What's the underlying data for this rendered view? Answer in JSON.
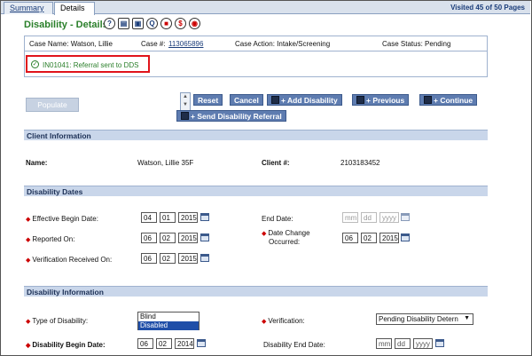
{
  "tabs": {
    "summary": "Summary",
    "details": "Details"
  },
  "visited": "Visited 45 of 50 Pages",
  "page_title": "Disability - Details",
  "title_icons": [
    "?",
    "▤",
    "▣",
    "Q",
    "■",
    "$",
    "◉"
  ],
  "case": {
    "name_label": "Case Name:",
    "name": "Watson, Lillie",
    "number_label": "Case #:",
    "number": "113065896",
    "action_label": "Case Action:",
    "action": "Intake/Screening",
    "status_label": "Case Status:",
    "status": "Pending"
  },
  "alert": {
    "icon": "✓",
    "text": "IN01041: Referral sent to DDS"
  },
  "buttons": {
    "populate": "Populate",
    "reset": "Reset",
    "cancel": "Cancel",
    "add_disability": "+ Add Disability",
    "previous": "+ Previous",
    "continue": "+ Continue",
    "send_referral": "+ Send Disability Referral"
  },
  "client": {
    "section": "Client Information",
    "name_label": "Name:",
    "name": "Watson, Lillie 35F",
    "client_num_label": "Client #:",
    "client_num": "2103183452"
  },
  "dates": {
    "section": "Disability Dates",
    "effective_label": "Effective Begin Date:",
    "effective": [
      "04",
      "01",
      "2015"
    ],
    "end_label": "End Date:",
    "end_ph": [
      "mm",
      "dd",
      "yyyy"
    ],
    "reported_label": "Reported On:",
    "reported": [
      "06",
      "02",
      "2015"
    ],
    "change_label": "Date Change",
    "change_label2": "Occurred:",
    "change": [
      "06",
      "02",
      "2015"
    ],
    "verification_label": "Verification Received On:",
    "verification": [
      "06",
      "02",
      "2015"
    ]
  },
  "info": {
    "section": "Disability Information",
    "type_label": "Type of Disability:",
    "type_options": [
      "Blind",
      "Disabled"
    ],
    "verification_label": "Verification:",
    "verification_value": "Pending Disability Detern",
    "begin_label": "Disability Begin Date:",
    "begin": [
      "06",
      "02",
      "2014"
    ],
    "end_label": "Disability End Date:",
    "end_ph": [
      "mm",
      "dd",
      "yyyy"
    ]
  }
}
